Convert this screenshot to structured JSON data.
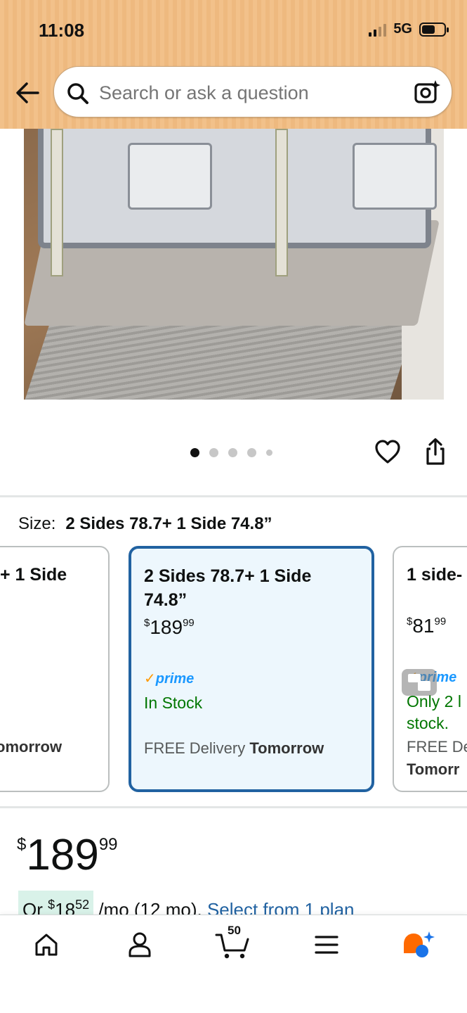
{
  "status_bar": {
    "time": "11:08",
    "network": "5G"
  },
  "search": {
    "placeholder": "Search or ask a question"
  },
  "gallery": {
    "dot_count": 5,
    "active_index": 0
  },
  "size": {
    "label": "Size:",
    "selected": "2 Sides 78.7+ 1 Side 74.8”"
  },
  "size_options": [
    {
      "title": "+ 1 Side",
      "delivery_partial": "omorrow"
    },
    {
      "title": "2 Sides 78.7+ 1 Side 74.8”",
      "price_currency": "$",
      "price_whole": "189",
      "price_fraction": "99",
      "prime": "prime",
      "stock": "In Stock",
      "delivery_text": "FREE Delivery",
      "delivery_day": "Tomorrow"
    },
    {
      "title": "1 side-",
      "price_currency": "$",
      "price_whole": "81",
      "price_fraction": "99",
      "prime": "prime",
      "stock": "Only 2 l stock.",
      "delivery_text": "FREE De",
      "delivery_day": "Tomorr"
    }
  ],
  "price": {
    "currency": "$",
    "whole": "189",
    "fraction": "99"
  },
  "installment": {
    "prefix": "Or",
    "currency": "$",
    "whole": "18",
    "fraction": "52",
    "suffix": "/mo (12 mo).",
    "link": "Select from 1 plan"
  },
  "bottom_nav": {
    "cart_count": "50",
    "accent_color": "#ff6a00"
  }
}
